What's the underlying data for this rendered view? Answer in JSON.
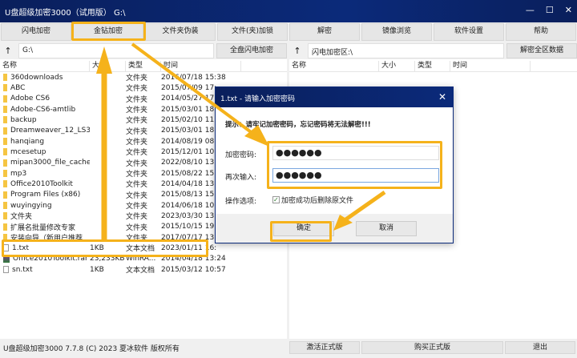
{
  "window": {
    "title": "U盘超级加密3000（试用版）  G:\\",
    "controls": [
      "—",
      "☐",
      "✕"
    ]
  },
  "toolbar": [
    "闪电加密",
    "金钻加密",
    "文件夹伪装",
    "文件(夹)加锁",
    "解密",
    "镜像浏览",
    "软件设置",
    "帮助"
  ],
  "left": {
    "path": "G:\\",
    "action": "全盘闪电加密",
    "headers": [
      "名称",
      "大小",
      "类型",
      "时间"
    ],
    "rows": [
      {
        "icon": "folder",
        "name": "360downloads",
        "size": "",
        "type": "文件夹",
        "time": "2016/07/18 15:38"
      },
      {
        "icon": "folder",
        "name": "ABC",
        "size": "",
        "type": "文件夹",
        "time": "2015/07/09 17:"
      },
      {
        "icon": "folder",
        "name": "Adobe CS6",
        "size": "",
        "type": "文件夹",
        "time": "2014/05/27 17:"
      },
      {
        "icon": "folder",
        "name": "Adobe-CS6-amtlib",
        "size": "",
        "type": "文件夹",
        "time": "2015/03/01 18:"
      },
      {
        "icon": "folder",
        "name": "backup",
        "size": "",
        "type": "文件夹",
        "time": "2015/02/10 11:"
      },
      {
        "icon": "folder",
        "name": "Dreamweaver_12_LS3",
        "size": "",
        "type": "文件夹",
        "time": "2015/03/01 18:"
      },
      {
        "icon": "folder",
        "name": "hanqiang",
        "size": "",
        "type": "文件夹",
        "time": "2014/08/19 08:"
      },
      {
        "icon": "folder",
        "name": "mcesetup",
        "size": "",
        "type": "文件夹",
        "time": "2015/12/01 10:"
      },
      {
        "icon": "folder",
        "name": "mipan3000_file_cache",
        "size": "",
        "type": "文件夹",
        "time": "2022/08/10 13:"
      },
      {
        "icon": "folder",
        "name": "mp3",
        "size": "",
        "type": "文件夹",
        "time": "2015/08/22 15:"
      },
      {
        "icon": "folder",
        "name": "Office2010Toolkit",
        "size": "",
        "type": "文件夹",
        "time": "2014/04/18 13:"
      },
      {
        "icon": "folder",
        "name": "Program Files (x86)",
        "size": "",
        "type": "文件夹",
        "time": "2015/08/13 15:"
      },
      {
        "icon": "folder",
        "name": "wuyingying",
        "size": "",
        "type": "文件夹",
        "time": "2014/06/18 10:"
      },
      {
        "icon": "folder",
        "name": "文件夹",
        "size": "",
        "type": "文件夹",
        "time": "2023/03/30 13:"
      },
      {
        "icon": "folder",
        "name": "扩展名批量修改专家",
        "size": "",
        "type": "文件夹",
        "time": "2015/10/15 19:"
      },
      {
        "icon": "folder",
        "name": "安装向导（新用户推荐",
        "size": "",
        "type": "文件夹",
        "time": "2017/07/17 13:"
      },
      {
        "icon": "file",
        "name": "1.txt",
        "size": "1KB",
        "type": "文本文档",
        "time": "2023/01/11 16:"
      },
      {
        "icon": "rar",
        "name": "Office2010Toolkit.rar",
        "size": "23,233KB",
        "type": "WinRA...",
        "time": "2014/04/18 13:24"
      },
      {
        "icon": "file",
        "name": "sn.txt",
        "size": "1KB",
        "type": "文本文档",
        "time": "2015/03/12 10:57"
      }
    ]
  },
  "right": {
    "path": "闪电加密区:\\",
    "action": "解密全区数据",
    "headers": [
      "名称",
      "大小",
      "类型",
      "时间"
    ]
  },
  "status": {
    "text": "U盘超级加密3000 7.7.8 (C) 2023 夏冰软件 版权所有",
    "buttons": [
      "激活正式版",
      "购买正式版",
      "退出"
    ]
  },
  "dialog": {
    "title": "1.txt - 请输入加密密码",
    "warning": "提示：请牢记加密密码，忘记密码将无法解密!!!",
    "password_label": "加密密码:",
    "password_value": "●●●●●●",
    "confirm_label": "再次输入:",
    "confirm_value": "●●●●●●",
    "options_label": "操作选项:",
    "delete_option": "加密成功后删除原文件",
    "delete_checked": true,
    "ok": "确定",
    "cancel": "取消"
  },
  "colors": {
    "titlebar": "#0b2a7a",
    "highlight": "#f5b21b"
  }
}
